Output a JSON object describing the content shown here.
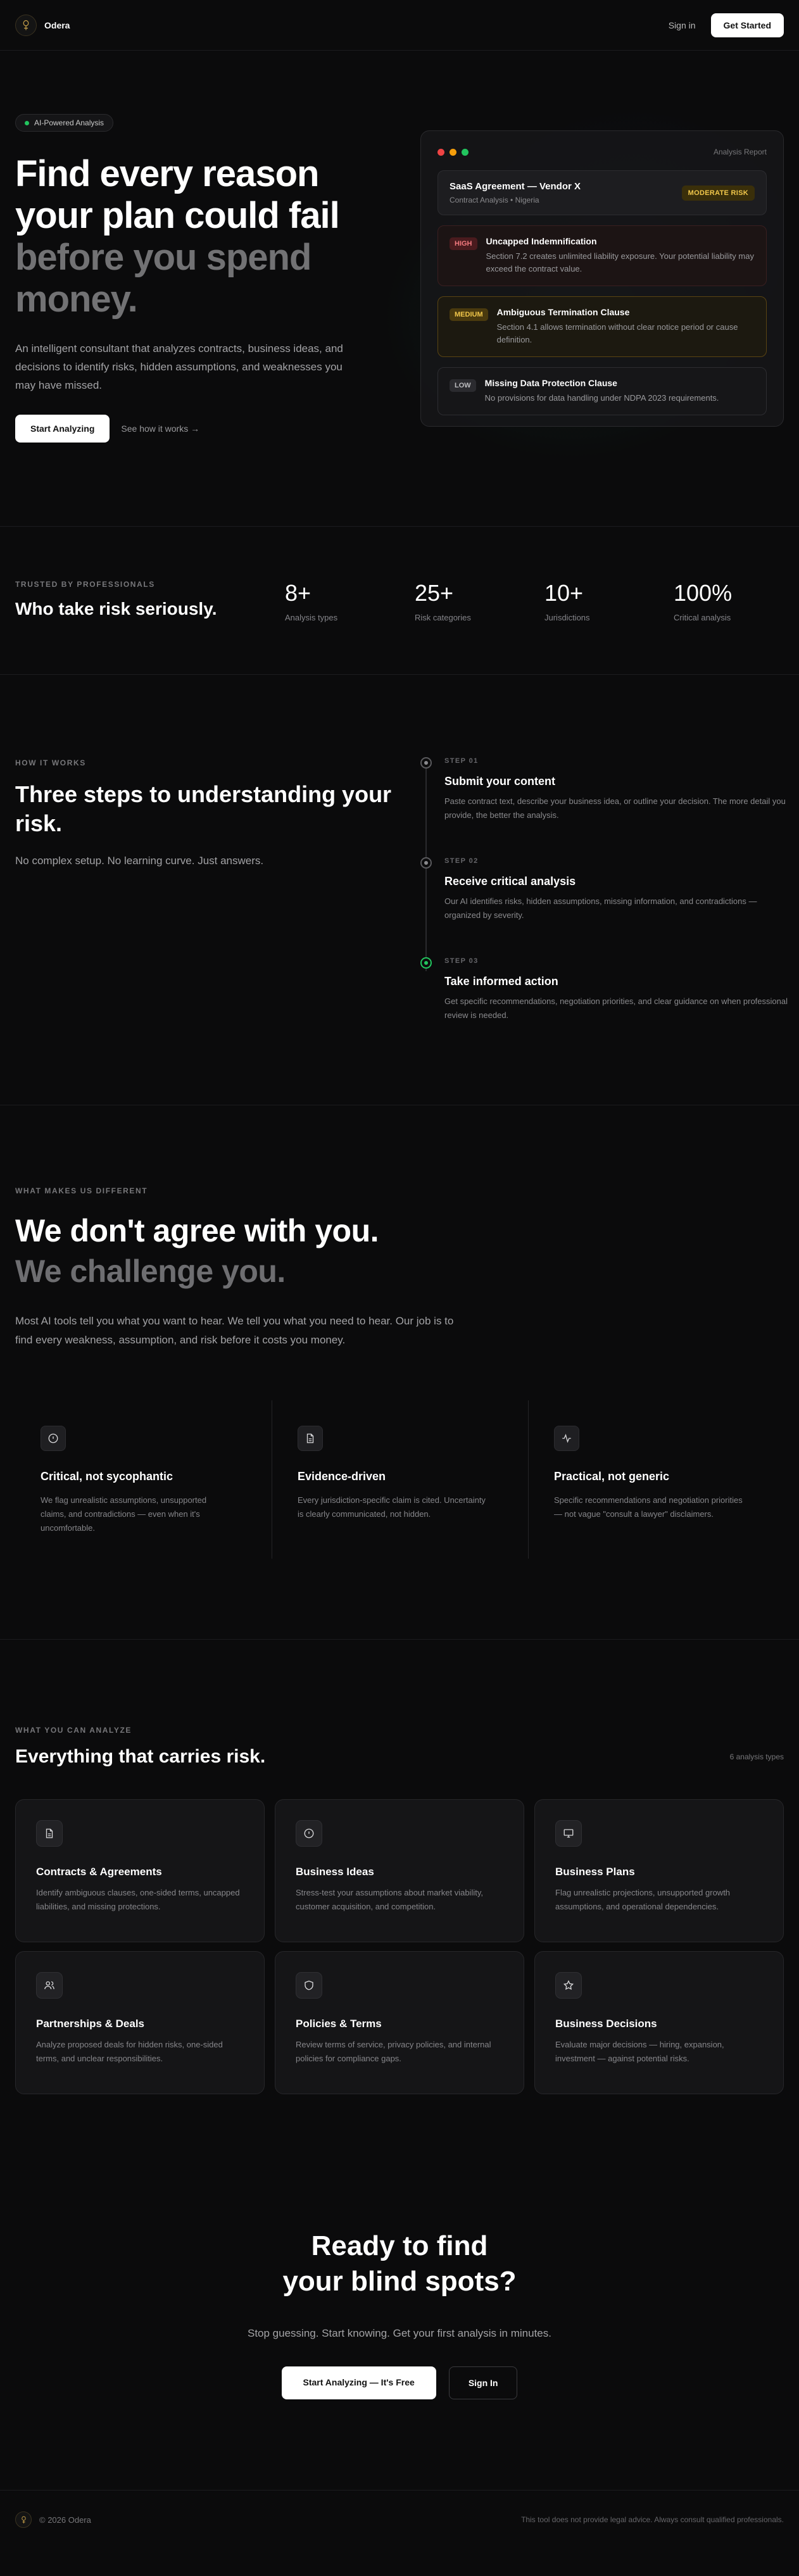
{
  "nav": {
    "brand": "Odera",
    "signin": "Sign in",
    "get_started": "Get Started"
  },
  "hero": {
    "pill": "AI-Powered Analysis",
    "title_line1": "Find every reason",
    "title_line2": "your plan could fail",
    "title_dim1": "before you spend",
    "title_dim2": "money.",
    "subtitle": "An intelligent consultant that analyzes contracts, business ideas, and decisions to identify risks, hidden assumptions, and weaknesses you may have missed.",
    "primary_cta": "Start Analyzing",
    "secondary_cta": "See how it works →"
  },
  "report": {
    "label": "Analysis Report",
    "dot_colors": [
      "#ef4444",
      "#f59e0b",
      "#22c55e"
    ],
    "agreement_title": "SaaS Agreement — Vendor X",
    "agreement_sub": "Contract Analysis • Nigeria",
    "agreement_badge": "MODERATE RISK",
    "items": [
      {
        "tag": "HIGH",
        "title": "Uncapped Indemnification",
        "desc": "Section 7.2 creates unlimited liability exposure. Your potential liability may exceed the contract value."
      },
      {
        "tag": "MEDIUM",
        "title": "Ambiguous Termination Clause",
        "desc": "Section 4.1 allows termination without clear notice period or cause definition."
      },
      {
        "tag": "LOW",
        "title": "Missing Data Protection Clause",
        "desc": "No provisions for data handling under NDPA 2023 requirements."
      }
    ]
  },
  "trusted": {
    "eyebrow": "TRUSTED BY PROFESSIONALS",
    "title": "Who take risk seriously.",
    "stats": [
      {
        "value": "8+",
        "label": "Analysis types"
      },
      {
        "value": "25+",
        "label": "Risk categories"
      },
      {
        "value": "10+",
        "label": "Jurisdictions"
      },
      {
        "value": "100%",
        "label": "Critical analysis"
      }
    ]
  },
  "how": {
    "eyebrow": "HOW IT WORKS",
    "title": "Three steps to understanding your risk.",
    "subtitle": "No complex setup. No learning curve. Just answers.",
    "steps": [
      {
        "kicker": "STEP 01",
        "title": "Submit your content",
        "desc": "Paste contract text, describe your business idea, or outline your decision. The more detail you provide, the better the analysis."
      },
      {
        "kicker": "STEP 02",
        "title": "Receive critical analysis",
        "desc": "Our AI identifies risks, hidden assumptions, missing information, and contradictions — organized by severity."
      },
      {
        "kicker": "STEP 03",
        "title": "Take informed action",
        "desc": "Get specific recommendations, negotiation priorities, and clear guidance on when professional review is needed."
      }
    ]
  },
  "different": {
    "eyebrow": "WHAT MAKES US DIFFERENT",
    "title_line1": "We don't agree with you.",
    "title_dim": "We challenge you.",
    "subtitle": "Most AI tools tell you what you want to hear. We tell you what you need to hear. Our job is to find every weakness, assumption, and risk before it costs you money.",
    "features": [
      {
        "icon": "alert-circle-icon",
        "title": "Critical, not sycophantic",
        "desc": "We flag unrealistic assumptions, unsupported claims, and contradictions — even when it's uncomfortable."
      },
      {
        "icon": "document-icon",
        "title": "Evidence-driven",
        "desc": "Every jurisdiction-specific claim is cited. Uncertainty is clearly communicated, not hidden."
      },
      {
        "icon": "activity-icon",
        "title": "Practical, not generic",
        "desc": "Specific recommendations and negotiation priorities — not vague \"consult a lawyer\" disclaimers."
      }
    ]
  },
  "analyze": {
    "eyebrow": "WHAT YOU CAN ANALYZE",
    "title": "Everything that carries risk.",
    "count": "6 analysis types",
    "cards": [
      {
        "icon": "document-icon",
        "title": "Contracts & Agreements",
        "desc": "Identify ambiguous clauses, one-sided terms, uncapped liabilities, and missing protections."
      },
      {
        "icon": "lightbulb-icon",
        "title": "Business Ideas",
        "desc": "Stress-test your assumptions about market viability, customer acquisition, and competition."
      },
      {
        "icon": "monitor-icon",
        "title": "Business Plans",
        "desc": "Flag unrealistic projections, unsupported growth assumptions, and operational dependencies."
      },
      {
        "icon": "users-icon",
        "title": "Partnerships & Deals",
        "desc": "Analyze proposed deals for hidden risks, one-sided terms, and unclear responsibilities."
      },
      {
        "icon": "shield-icon",
        "title": "Policies & Terms",
        "desc": "Review terms of service, privacy policies, and internal policies for compliance gaps."
      },
      {
        "icon": "star-icon",
        "title": "Business Decisions",
        "desc": "Evaluate major decisions — hiring, expansion, investment — against potential risks."
      }
    ]
  },
  "cta": {
    "title_line1": "Ready to find",
    "title_line2": "your blind spots?",
    "subtitle": "Stop guessing. Start knowing. Get your first analysis in minutes.",
    "primary": "Start Analyzing — It's Free",
    "secondary": "Sign In"
  },
  "footer": {
    "copyright": "© 2026 Odera",
    "disclaimer": "This tool does not provide legal advice. Always consult qualified professionals."
  },
  "colors": {
    "accent_green": "#22c55e",
    "risk_high": "#f47a7f",
    "risk_medium": "#f2c84b",
    "logo_gold": "#c9a24a"
  }
}
